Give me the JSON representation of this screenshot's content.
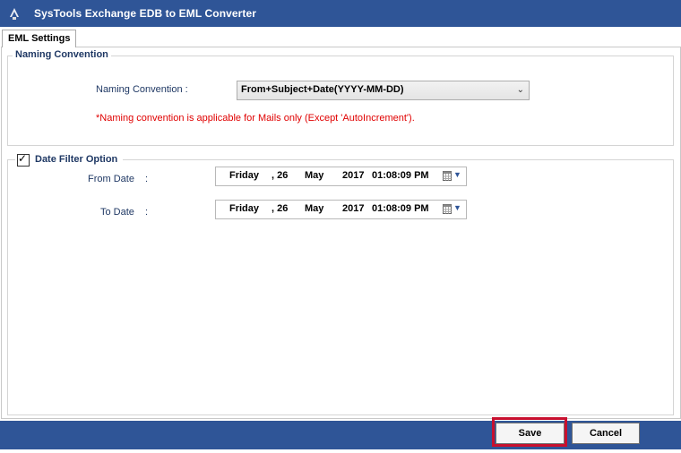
{
  "app": {
    "title": "SysTools  Exchange EDB to EML Converter"
  },
  "tabs": [
    {
      "label": "EML Settings",
      "active": true
    }
  ],
  "naming_group": {
    "legend": "Naming Convention",
    "field_label": "Naming Convention :",
    "selected_value": "From+Subject+Date(YYYY-MM-DD)",
    "note": "*Naming convention is applicable for Mails only (Except 'AutoIncrement')."
  },
  "date_filter": {
    "legend": "Date Filter Option",
    "checked": true,
    "from": {
      "label": "From Date",
      "colon": ":",
      "day_name": "Friday",
      "day": ", 26",
      "month": "May",
      "year": "2017",
      "time": "01:08:09 PM"
    },
    "to": {
      "label": "To Date",
      "colon": ":",
      "day_name": "Friday",
      "day": ", 26",
      "month": "May",
      "year": "2017",
      "time": "01:08:09 PM"
    }
  },
  "buttons": {
    "save": "Save",
    "cancel": "Cancel"
  },
  "colors": {
    "titlebar": "#2f5597",
    "warning": "#e00000",
    "highlight": "#c8102e"
  }
}
